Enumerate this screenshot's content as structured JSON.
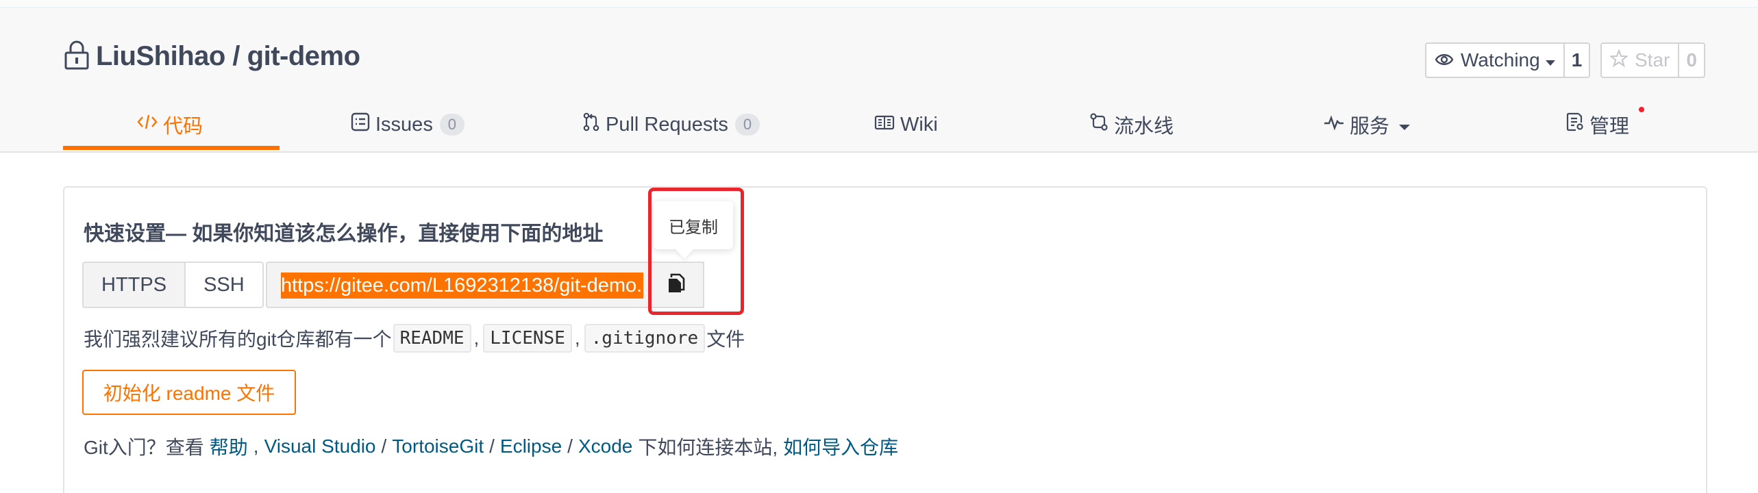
{
  "repo": {
    "title": "LiuShihao / git-demo"
  },
  "watch": {
    "label": "Watching",
    "count": "1"
  },
  "star": {
    "label": "Star",
    "count": "0"
  },
  "tabs": [
    {
      "label": "代码",
      "icon": "code-icon",
      "active": true
    },
    {
      "label": "Issues",
      "icon": "issues-icon",
      "badge": "0"
    },
    {
      "label": "Pull Requests",
      "icon": "pull-request-icon",
      "badge": "0"
    },
    {
      "label": "Wiki",
      "icon": "book-icon"
    },
    {
      "label": "流水线",
      "icon": "pipeline-icon"
    },
    {
      "label": "服务",
      "icon": "pulse-icon",
      "dropdown": true
    },
    {
      "label": "管理",
      "icon": "manage-icon"
    }
  ],
  "quick_setup": {
    "title": "快速设置— 如果你知道该怎么操作，直接使用下面的地址",
    "protocols": [
      "HTTPS",
      "SSH"
    ],
    "url": "https://gitee.com/L1692312138/git-demo.",
    "copied_tooltip": "已复制"
  },
  "recommend": {
    "prefix": "我们强烈建议所有的git仓库都有一个",
    "files": [
      "README",
      "LICENSE",
      ".gitignore"
    ],
    "comma": ",",
    "suffix": "文件"
  },
  "init_button": "初始化 readme 文件",
  "help": {
    "prefix": "Git入门？查看",
    "help_link": "帮助",
    "comma1": ",",
    "visual_studio": "Visual Studio",
    "slash": "/",
    "tortoisegit": "TortoiseGit",
    "eclipse": "Eclipse",
    "xcode": "Xcode",
    "middle": "下如何连接本站,",
    "import_link": "如何导入仓库"
  },
  "colors": {
    "accent": "#fe7300",
    "link": "#005980",
    "highlight_frame": "#e8262b",
    "notification_dot": "#f5222d"
  }
}
